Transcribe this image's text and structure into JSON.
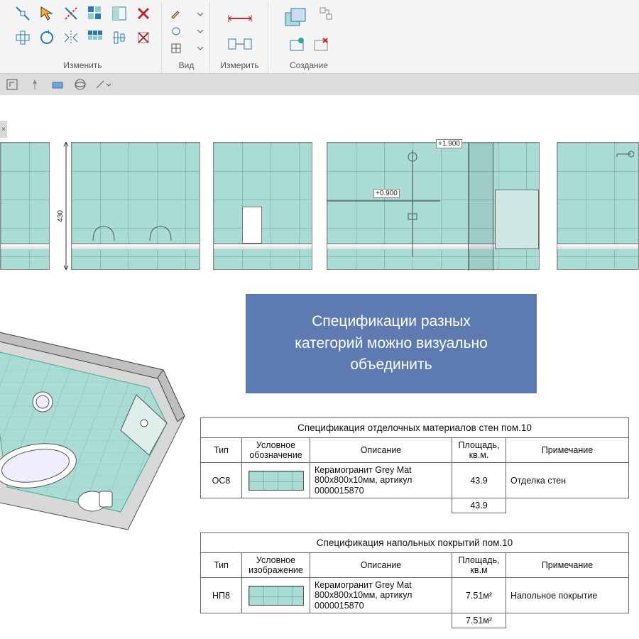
{
  "ribbon": {
    "groups": {
      "modify": {
        "label": "Изменить"
      },
      "view": {
        "label": "Вид"
      },
      "measure": {
        "label": "Измерить"
      },
      "create": {
        "label": "Создание"
      }
    }
  },
  "tab_close": "×",
  "elevations": {
    "dim_430": "430",
    "dim_0_900": "+0.900",
    "dim_1_900": "+1.900"
  },
  "callout": {
    "line1": "Спецификации разных",
    "line2": "категорий можно визуально",
    "line3": "объединить"
  },
  "table1": {
    "title": "Спецификация отделочных материалов стен пом.10",
    "headers": {
      "type": "Тип",
      "symbol": "Условное обозначение",
      "desc": "Описание",
      "area": "Площадь, кв.м.",
      "note": "Примечание"
    },
    "row": {
      "type": "ОС8",
      "desc_l1": "Керамогранит Grey Mat",
      "desc_l2": "800x800x10мм, артикул",
      "desc_l3": "0000015870",
      "area": "43.9",
      "note": "Отделка стен"
    },
    "total_area": "43.9"
  },
  "table2": {
    "title": "Спецификация напольных покрытий пом.10",
    "headers": {
      "type": "Тип",
      "symbol": "Условное изображение",
      "desc": "Описание",
      "area": "Площадь, кв.м",
      "note": "Примечание"
    },
    "row": {
      "type": "НП8",
      "desc_l1": "Керамогранит Grey Mat",
      "desc_l2": "800x800x10мм, артикул",
      "desc_l3": "0000015870",
      "area": "7.51м²",
      "note": "Напольное покрытие"
    },
    "total_area": "7.51м²"
  }
}
